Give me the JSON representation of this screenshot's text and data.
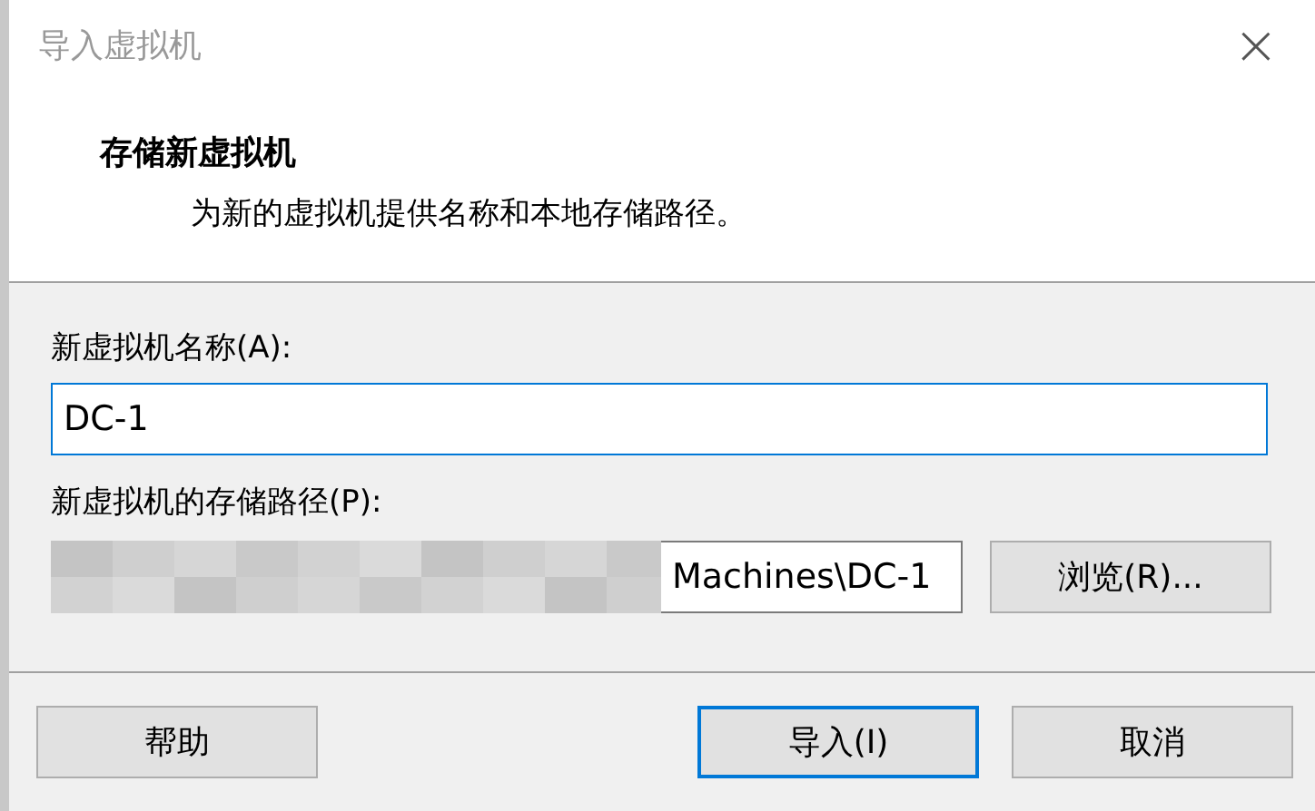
{
  "window": {
    "title": "导入虚拟机",
    "close": "×"
  },
  "header": {
    "title": "存储新虚拟机",
    "subtitle": "为新的虚拟机提供名称和本地存储路径。"
  },
  "name_field": {
    "label": "新虚拟机名称(A):",
    "value": "DC-1",
    "focused": true
  },
  "path_field": {
    "label": "新虚拟机的存储路径(P):",
    "value": "Machines\\DC-1",
    "focused": false,
    "browse": "浏览(R)..."
  },
  "buttons": [
    {
      "label": "帮助",
      "default": false
    },
    {
      "label": "导入(I)",
      "default": true
    },
    {
      "label": "取消",
      "default": false
    }
  ]
}
